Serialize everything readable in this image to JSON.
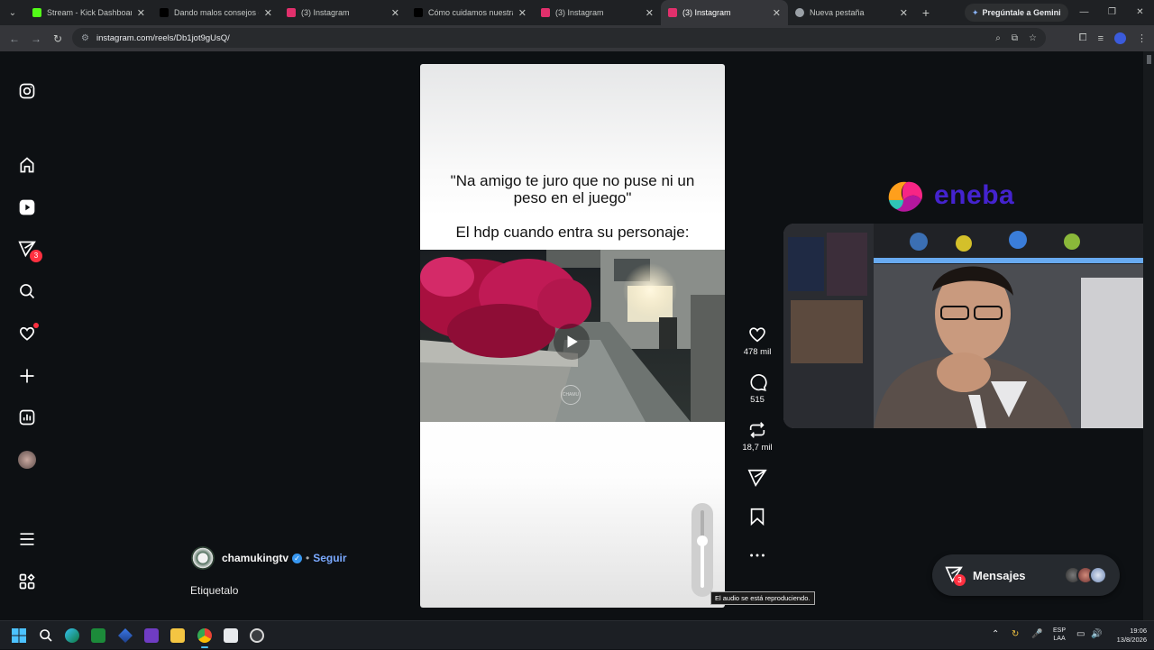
{
  "browser": {
    "tabs": [
      {
        "title": "Stream - Kick Dashboard",
        "fav_color": "#53fc18"
      },
      {
        "title": "Dando malos consejos de",
        "fav_color": "#000000"
      },
      {
        "title": "(3) Instagram",
        "fav_color": "#e1306c"
      },
      {
        "title": "Cómo cuidamos nuestra s",
        "fav_color": "#000000"
      },
      {
        "title": "(3) Instagram",
        "fav_color": "#e1306c"
      },
      {
        "title": "(3) Instagram",
        "fav_color": "#e1306c",
        "active": true
      },
      {
        "title": "Nueva pestaña",
        "fav_color": "#9aa0a6"
      }
    ],
    "gemini_label": "Pregúntale a Gemini",
    "url": "instagram.com/reels/Db1jot9gUsQ/"
  },
  "sidebar": {
    "notifications_badge": "3"
  },
  "reel": {
    "caption_quote": "\"Na amigo te juro que no puse ni un peso en el juego\"",
    "caption_line": "El hdp cuando entra su personaje:",
    "watermark": "CHAMU",
    "volume_level": 0.6,
    "tooltip": "El audio se está reproduciendo."
  },
  "actions": {
    "likes": "478 mil",
    "comments": "515",
    "reposts": "18,7 mil"
  },
  "author": {
    "username": "chamukingtv",
    "separator": "•",
    "follow_label": "Seguir",
    "tagline": "Etiquetalo"
  },
  "overlay": {
    "sponsor": "eneba"
  },
  "messages": {
    "label": "Mensajes",
    "badge": "3"
  },
  "taskbar": {
    "lang_line1": "ESP",
    "lang_line2": "LAA",
    "time": "19:06",
    "date": "13/8/2026"
  },
  "colors": {
    "accent_blue": "#3797f0",
    "badge_red": "#ff3040",
    "eneba_purple": "#4423cf"
  }
}
